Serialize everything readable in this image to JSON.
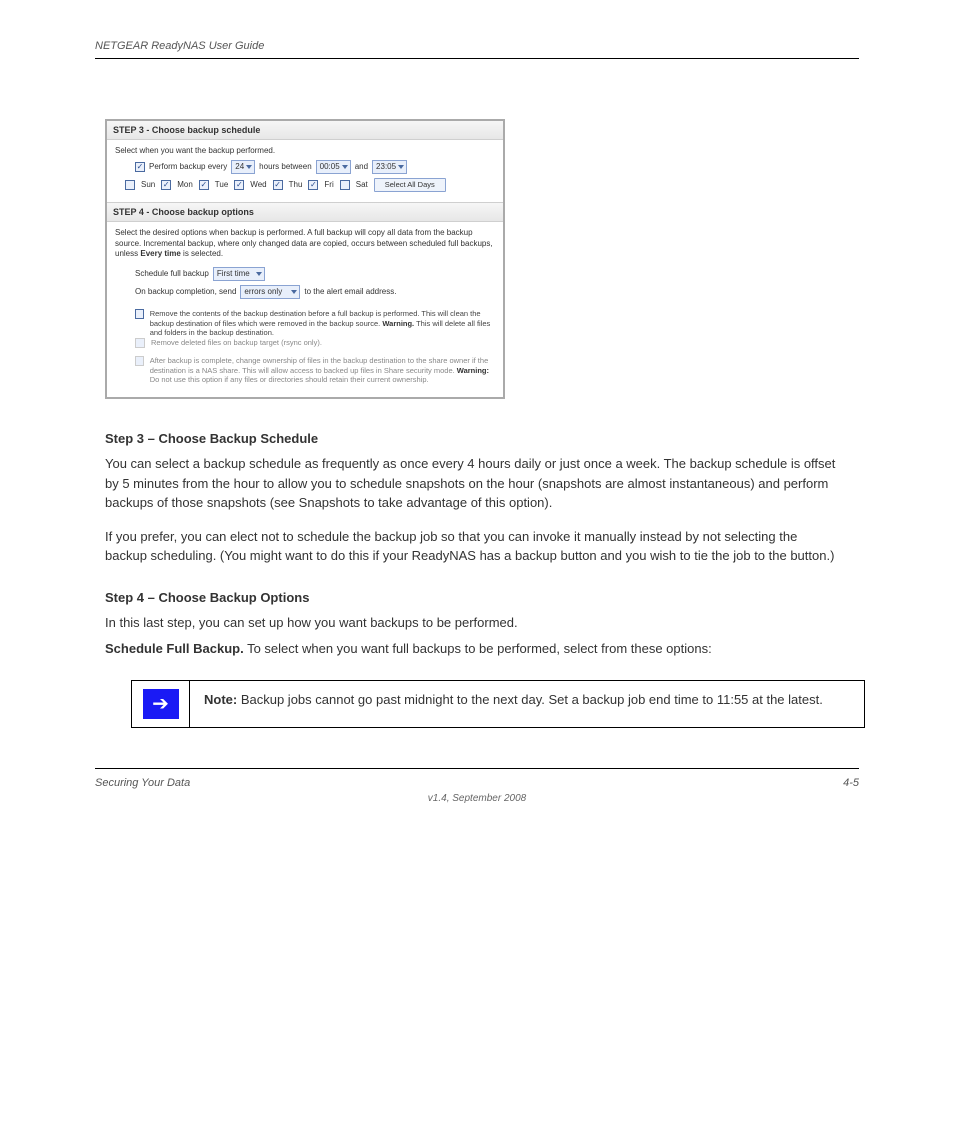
{
  "header": {
    "left": "NETGEAR ReadyNAS User Guide",
    "right": ""
  },
  "wizard": {
    "step3": {
      "title": "STEP 3 - Choose backup schedule",
      "intro": "Select when you want the backup performed.",
      "perform_label_a": "Perform backup every",
      "every_value": "24",
      "perform_label_b": "hours between",
      "start_value": "00:05",
      "and_label": "and",
      "end_value": "23:05",
      "days": [
        {
          "name": "Sun",
          "checked": false
        },
        {
          "name": "Mon",
          "checked": true
        },
        {
          "name": "Tue",
          "checked": true
        },
        {
          "name": "Wed",
          "checked": true
        },
        {
          "name": "Thu",
          "checked": true
        },
        {
          "name": "Fri",
          "checked": true
        },
        {
          "name": "Sat",
          "checked": false
        }
      ],
      "select_all": "Select All Days",
      "perform_checked": true
    },
    "step4": {
      "title": "STEP 4 - Choose backup options",
      "intro_a": "Select the desired options when backup is performed. A full backup will copy all data from the backup source. Incremental backup, where only changed data are copied, occurs between scheduled full backups, unless ",
      "intro_bold": "Every time",
      "intro_b": " is selected.",
      "sched_label": "Schedule full backup",
      "sched_value": "First time",
      "send_label_a": "On backup completion, send",
      "send_value": "errors only",
      "send_label_b": "to the alert email address.",
      "opt1_a": "Remove the contents of the backup destination before a full backup is performed. This will clean the backup destination of files which were removed in the backup source. ",
      "opt1_warn": "Warning.",
      "opt1_b": " This will delete all files and folders in the backup destination.",
      "opt1b": "Remove deleted files on backup target (rsync only).",
      "opt1b_checked": false,
      "opt1_checked": false,
      "opt2_a": "After backup is complete, change ownership of files in the backup destination to the share owner if the destination is a NAS share. This will allow access to backed up files in Share security mode. ",
      "opt2_warn": "Warning:",
      "opt2_b": " Do not use this option if any files or directories should retain their current ownership.",
      "opt2_checked": false
    }
  },
  "body": {
    "sec1_title": "Step 3 – Choose Backup Schedule",
    "sec1_p": "You can select a backup schedule as frequently as once every 4 hours daily or just once a week. The backup schedule is offset by 5 minutes from the hour to allow you to schedule snapshots on the hour (snapshots are almost instantaneous) and perform backups of those snapshots (see Snapshots to take advantage of this option).",
    "sec1_p2": "If you prefer, you can elect not to schedule the backup job so that you can invoke it manually instead by not selecting the backup scheduling. (You might want to do this if your ReadyNAS has a backup button and you wish to tie the job to the button.)",
    "sec2_title": "Step 4 – Choose Backup Options",
    "sec2_p": "In this last step, you can set up how you want backups to be performed.",
    "sec2_sub": "Schedule Full Backup.",
    "sec2_sub_p": " To select when you want full backups to be performed, select from these options:"
  },
  "note": {
    "label": "Note:",
    "text": " Backup jobs cannot go past midnight to the next day. Set a backup job end time to 11:55 at the latest."
  },
  "footer": {
    "left": "Securing Your Data",
    "right": "4-5",
    "version": "v1.4, September 2008"
  }
}
